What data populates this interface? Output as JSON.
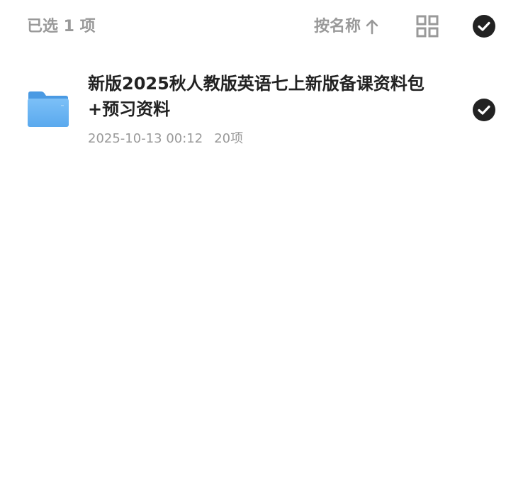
{
  "header": {
    "selected_count": "已选 1 项",
    "sort_label": "按名称",
    "sort_direction_icon": "arrow-up-icon",
    "view_toggle_icon": "grid-view-icon",
    "select_all_icon": "check-circle-icon"
  },
  "files": [
    {
      "name": "新版2025秋人教版英语七上新版备课资料包+预习资料",
      "date": "2025-10-13 00:12",
      "item_count": "20项",
      "icon": "folder-icon",
      "selected": true
    }
  ],
  "colors": {
    "text_primary": "#222222",
    "text_secondary": "#999999",
    "check_bg": "#222222",
    "folder_blue": "#5aa9ee",
    "background": "#ffffff"
  }
}
